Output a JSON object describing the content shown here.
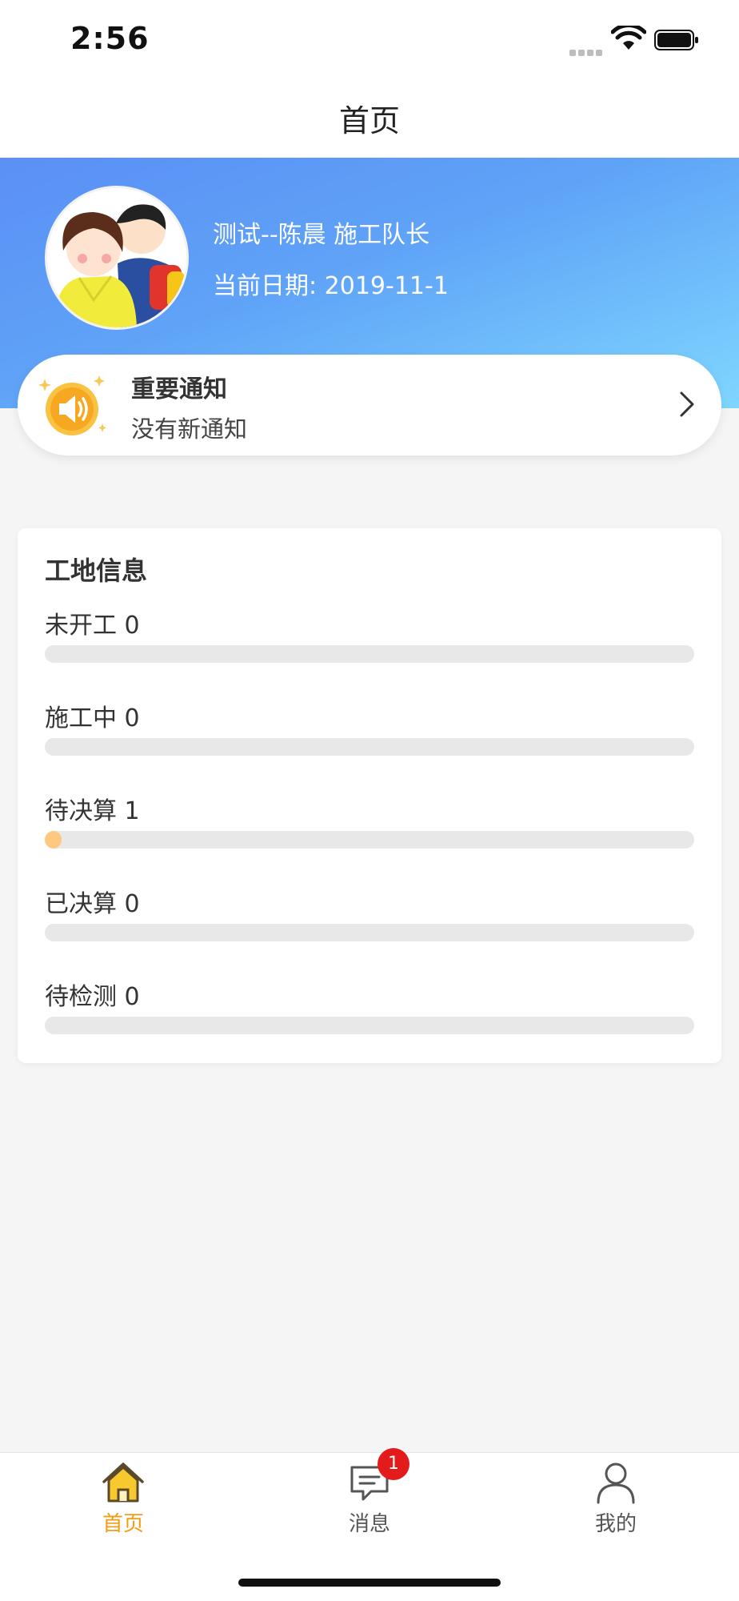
{
  "status_bar": {
    "time": "2:56"
  },
  "nav": {
    "title": "首页"
  },
  "user": {
    "name_role": "测试--陈晨  施工队长",
    "date": "当前日期: 2019-11-1"
  },
  "notice": {
    "title": "重要通知",
    "subtitle": "没有新通知"
  },
  "site_info": {
    "title": "工地信息",
    "stats": [
      {
        "label": "未开工 0",
        "progress": 0
      },
      {
        "label": "施工中 0",
        "progress": 0
      },
      {
        "label": "待决算 1",
        "progress": 0.02
      },
      {
        "label": "已决算 0",
        "progress": 0
      },
      {
        "label": "待检测 0",
        "progress": 0
      }
    ]
  },
  "tabs": [
    {
      "label": "首页",
      "icon": "home-icon",
      "active": true
    },
    {
      "label": "消息",
      "icon": "message-icon",
      "badge": "1"
    },
    {
      "label": "我的",
      "icon": "user-icon"
    }
  ],
  "colors": {
    "accent": "#f39c12",
    "banner_start": "#5b8ff5",
    "banner_end": "#7fd6ff",
    "badge": "#e31b1b",
    "progress_fill": "#ffc880"
  }
}
